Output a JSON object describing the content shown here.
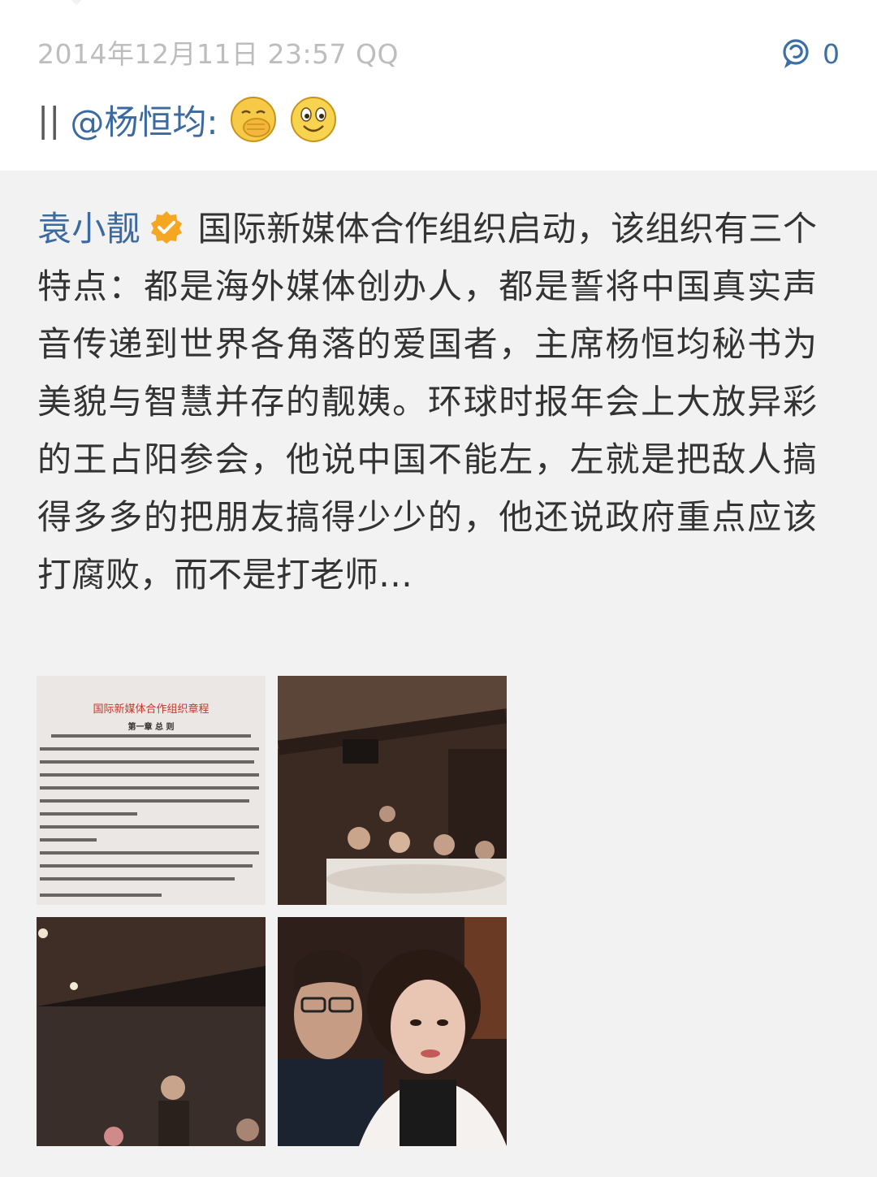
{
  "post": {
    "timestamp": "2014年12月11日 23:57 QQ",
    "comment_count": "0",
    "separator": "||",
    "mention": "@杨恒均:"
  },
  "quoted": {
    "author": "袁小靓",
    "text": "国际新媒体合作组织启动，该组织有三个特点：都是海外媒体创办人，都是誓将中国真实声音传递到世界各角落的爱国者，主席杨恒均秘书为美貌与智慧并存的靓姨。环球时报年会上大放异彩的王占阳参会，他说中国不能左，左就是把敌人搞得多多的把朋友搞得少少的，他还说政府重点应该打腐败，而不是打老师…"
  },
  "photos": {
    "doc_title": "国际新媒体合作组织章程",
    "doc_chapter": "第一章 总 则"
  },
  "icons": [
    "comment-icon",
    "cover-mouth-emoji",
    "smile-emoji",
    "verified-badge-icon"
  ],
  "colors": {
    "link": "#3b6aa0",
    "timestamp": "#bdbdbd",
    "quote_bg": "#f2f2f2",
    "verified": "#f5a623"
  }
}
